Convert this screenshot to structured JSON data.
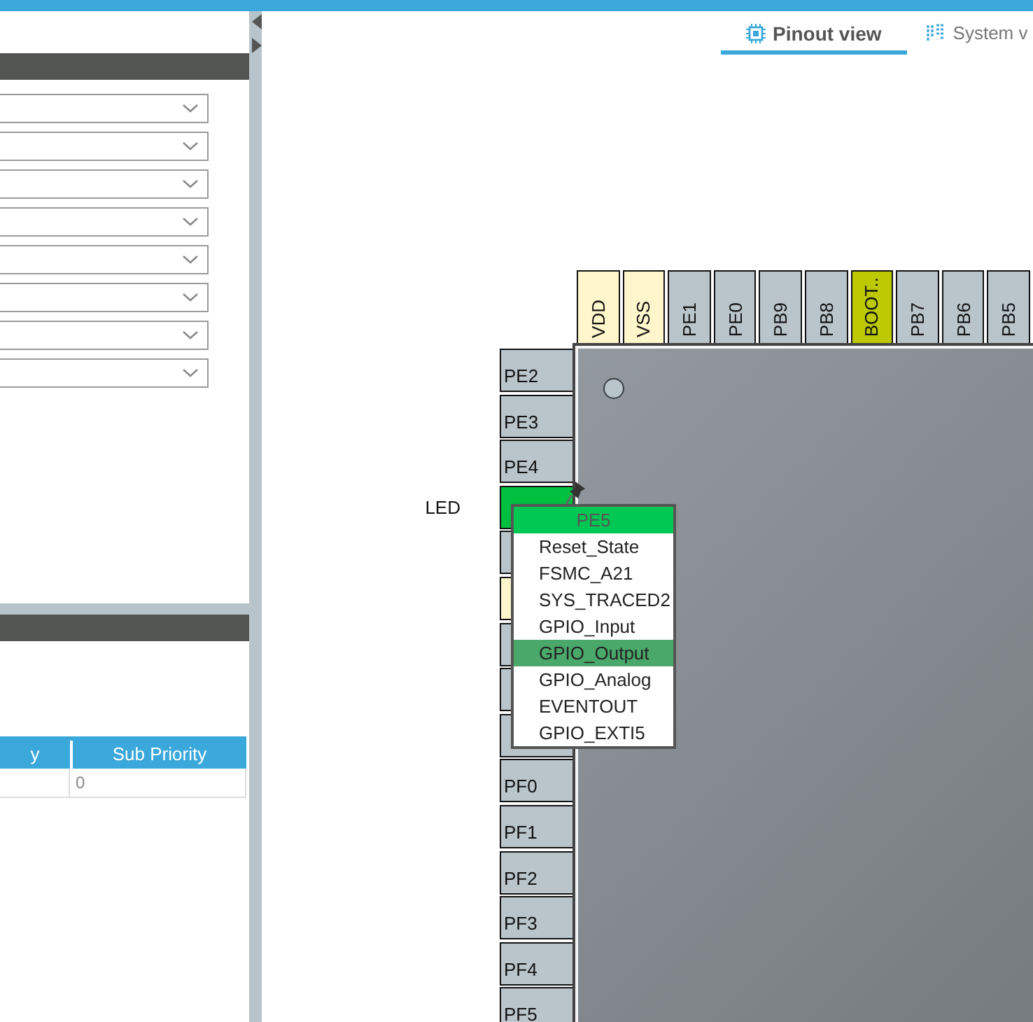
{
  "tabs": [
    {
      "label": "Pinout view",
      "selected": true
    },
    {
      "label": "System v",
      "selected": false
    }
  ],
  "config_fields": [
    {
      "kind": "dropdown"
    },
    {
      "kind": "dropdown"
    },
    {
      "kind": "dropdown"
    },
    {
      "kind": "dropdown"
    },
    {
      "kind": "dropdown"
    },
    {
      "kind": "dropdown"
    },
    {
      "kind": "dropdown"
    },
    {
      "kind": "dropdown"
    }
  ],
  "nvic_table": {
    "columns": [
      "y",
      "Sub Priority"
    ],
    "rows": [
      {
        "column_1": null,
        "sub_priority": "0"
      }
    ]
  },
  "chip": {
    "top_pins": [
      {
        "label": "VDD",
        "kind": "power"
      },
      {
        "label": "VSS",
        "kind": "power"
      },
      {
        "label": "PE1",
        "kind": "io"
      },
      {
        "label": "PE0",
        "kind": "io"
      },
      {
        "label": "PB9",
        "kind": "io"
      },
      {
        "label": "PB8",
        "kind": "io"
      },
      {
        "label": "BOOT..",
        "kind": "boot"
      },
      {
        "label": "PB7",
        "kind": "io"
      },
      {
        "label": "PB6",
        "kind": "io"
      },
      {
        "label": "PB5",
        "kind": "io"
      }
    ],
    "left_pins": [
      {
        "label": "PE2",
        "kind": "io"
      },
      {
        "label": "PE3",
        "kind": "io"
      },
      {
        "label": "PE4",
        "kind": "io"
      },
      {
        "kind": "assigned",
        "signal": "LED"
      },
      {
        "kind": "io"
      },
      {
        "kind": "power"
      },
      {
        "kind": "io"
      },
      {
        "kind": "io"
      },
      {
        "kind": "io"
      },
      {
        "label": "PF0",
        "kind": "io"
      },
      {
        "label": "PF1",
        "kind": "io"
      },
      {
        "label": "PF2",
        "kind": "io"
      },
      {
        "label": "PF3",
        "kind": "io"
      },
      {
        "label": "PF4",
        "kind": "io"
      },
      {
        "label": "PF5",
        "kind": "io"
      }
    ]
  },
  "pin_menu": {
    "title": "PE5",
    "items": [
      {
        "label": "Reset_State",
        "selected": false
      },
      {
        "label": "FSMC_A21",
        "selected": false
      },
      {
        "label": "SYS_TRACED2",
        "selected": false
      },
      {
        "label": "GPIO_Input",
        "selected": false
      },
      {
        "label": "GPIO_Output",
        "selected": true
      },
      {
        "label": "GPIO_Analog",
        "selected": false
      },
      {
        "label": "EVENTOUT",
        "selected": false
      },
      {
        "label": "GPIO_EXTI5",
        "selected": false
      }
    ]
  }
}
